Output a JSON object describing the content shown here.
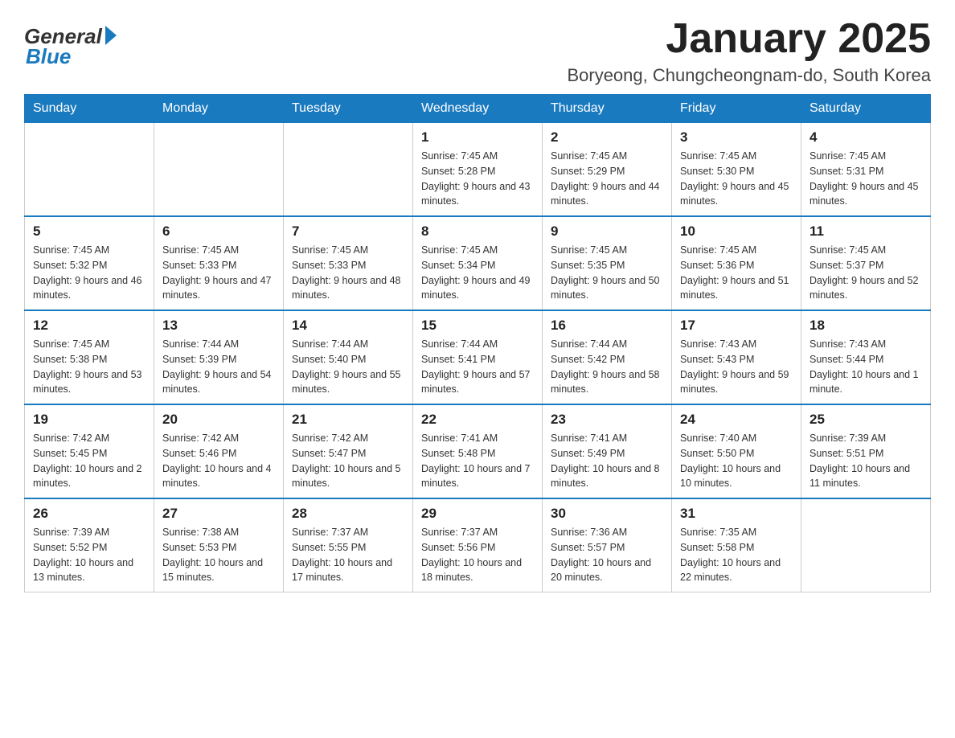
{
  "header": {
    "logo_general": "General",
    "logo_blue": "Blue",
    "month_title": "January 2025",
    "location": "Boryeong, Chungcheongnam-do, South Korea"
  },
  "weekdays": [
    "Sunday",
    "Monday",
    "Tuesday",
    "Wednesday",
    "Thursday",
    "Friday",
    "Saturday"
  ],
  "weeks": [
    [
      {
        "day": "",
        "sunrise": "",
        "sunset": "",
        "daylight": ""
      },
      {
        "day": "",
        "sunrise": "",
        "sunset": "",
        "daylight": ""
      },
      {
        "day": "",
        "sunrise": "",
        "sunset": "",
        "daylight": ""
      },
      {
        "day": "1",
        "sunrise": "Sunrise: 7:45 AM",
        "sunset": "Sunset: 5:28 PM",
        "daylight": "Daylight: 9 hours and 43 minutes."
      },
      {
        "day": "2",
        "sunrise": "Sunrise: 7:45 AM",
        "sunset": "Sunset: 5:29 PM",
        "daylight": "Daylight: 9 hours and 44 minutes."
      },
      {
        "day": "3",
        "sunrise": "Sunrise: 7:45 AM",
        "sunset": "Sunset: 5:30 PM",
        "daylight": "Daylight: 9 hours and 45 minutes."
      },
      {
        "day": "4",
        "sunrise": "Sunrise: 7:45 AM",
        "sunset": "Sunset: 5:31 PM",
        "daylight": "Daylight: 9 hours and 45 minutes."
      }
    ],
    [
      {
        "day": "5",
        "sunrise": "Sunrise: 7:45 AM",
        "sunset": "Sunset: 5:32 PM",
        "daylight": "Daylight: 9 hours and 46 minutes."
      },
      {
        "day": "6",
        "sunrise": "Sunrise: 7:45 AM",
        "sunset": "Sunset: 5:33 PM",
        "daylight": "Daylight: 9 hours and 47 minutes."
      },
      {
        "day": "7",
        "sunrise": "Sunrise: 7:45 AM",
        "sunset": "Sunset: 5:33 PM",
        "daylight": "Daylight: 9 hours and 48 minutes."
      },
      {
        "day": "8",
        "sunrise": "Sunrise: 7:45 AM",
        "sunset": "Sunset: 5:34 PM",
        "daylight": "Daylight: 9 hours and 49 minutes."
      },
      {
        "day": "9",
        "sunrise": "Sunrise: 7:45 AM",
        "sunset": "Sunset: 5:35 PM",
        "daylight": "Daylight: 9 hours and 50 minutes."
      },
      {
        "day": "10",
        "sunrise": "Sunrise: 7:45 AM",
        "sunset": "Sunset: 5:36 PM",
        "daylight": "Daylight: 9 hours and 51 minutes."
      },
      {
        "day": "11",
        "sunrise": "Sunrise: 7:45 AM",
        "sunset": "Sunset: 5:37 PM",
        "daylight": "Daylight: 9 hours and 52 minutes."
      }
    ],
    [
      {
        "day": "12",
        "sunrise": "Sunrise: 7:45 AM",
        "sunset": "Sunset: 5:38 PM",
        "daylight": "Daylight: 9 hours and 53 minutes."
      },
      {
        "day": "13",
        "sunrise": "Sunrise: 7:44 AM",
        "sunset": "Sunset: 5:39 PM",
        "daylight": "Daylight: 9 hours and 54 minutes."
      },
      {
        "day": "14",
        "sunrise": "Sunrise: 7:44 AM",
        "sunset": "Sunset: 5:40 PM",
        "daylight": "Daylight: 9 hours and 55 minutes."
      },
      {
        "day": "15",
        "sunrise": "Sunrise: 7:44 AM",
        "sunset": "Sunset: 5:41 PM",
        "daylight": "Daylight: 9 hours and 57 minutes."
      },
      {
        "day": "16",
        "sunrise": "Sunrise: 7:44 AM",
        "sunset": "Sunset: 5:42 PM",
        "daylight": "Daylight: 9 hours and 58 minutes."
      },
      {
        "day": "17",
        "sunrise": "Sunrise: 7:43 AM",
        "sunset": "Sunset: 5:43 PM",
        "daylight": "Daylight: 9 hours and 59 minutes."
      },
      {
        "day": "18",
        "sunrise": "Sunrise: 7:43 AM",
        "sunset": "Sunset: 5:44 PM",
        "daylight": "Daylight: 10 hours and 1 minute."
      }
    ],
    [
      {
        "day": "19",
        "sunrise": "Sunrise: 7:42 AM",
        "sunset": "Sunset: 5:45 PM",
        "daylight": "Daylight: 10 hours and 2 minutes."
      },
      {
        "day": "20",
        "sunrise": "Sunrise: 7:42 AM",
        "sunset": "Sunset: 5:46 PM",
        "daylight": "Daylight: 10 hours and 4 minutes."
      },
      {
        "day": "21",
        "sunrise": "Sunrise: 7:42 AM",
        "sunset": "Sunset: 5:47 PM",
        "daylight": "Daylight: 10 hours and 5 minutes."
      },
      {
        "day": "22",
        "sunrise": "Sunrise: 7:41 AM",
        "sunset": "Sunset: 5:48 PM",
        "daylight": "Daylight: 10 hours and 7 minutes."
      },
      {
        "day": "23",
        "sunrise": "Sunrise: 7:41 AM",
        "sunset": "Sunset: 5:49 PM",
        "daylight": "Daylight: 10 hours and 8 minutes."
      },
      {
        "day": "24",
        "sunrise": "Sunrise: 7:40 AM",
        "sunset": "Sunset: 5:50 PM",
        "daylight": "Daylight: 10 hours and 10 minutes."
      },
      {
        "day": "25",
        "sunrise": "Sunrise: 7:39 AM",
        "sunset": "Sunset: 5:51 PM",
        "daylight": "Daylight: 10 hours and 11 minutes."
      }
    ],
    [
      {
        "day": "26",
        "sunrise": "Sunrise: 7:39 AM",
        "sunset": "Sunset: 5:52 PM",
        "daylight": "Daylight: 10 hours and 13 minutes."
      },
      {
        "day": "27",
        "sunrise": "Sunrise: 7:38 AM",
        "sunset": "Sunset: 5:53 PM",
        "daylight": "Daylight: 10 hours and 15 minutes."
      },
      {
        "day": "28",
        "sunrise": "Sunrise: 7:37 AM",
        "sunset": "Sunset: 5:55 PM",
        "daylight": "Daylight: 10 hours and 17 minutes."
      },
      {
        "day": "29",
        "sunrise": "Sunrise: 7:37 AM",
        "sunset": "Sunset: 5:56 PM",
        "daylight": "Daylight: 10 hours and 18 minutes."
      },
      {
        "day": "30",
        "sunrise": "Sunrise: 7:36 AM",
        "sunset": "Sunset: 5:57 PM",
        "daylight": "Daylight: 10 hours and 20 minutes."
      },
      {
        "day": "31",
        "sunrise": "Sunrise: 7:35 AM",
        "sunset": "Sunset: 5:58 PM",
        "daylight": "Daylight: 10 hours and 22 minutes."
      },
      {
        "day": "",
        "sunrise": "",
        "sunset": "",
        "daylight": ""
      }
    ]
  ]
}
